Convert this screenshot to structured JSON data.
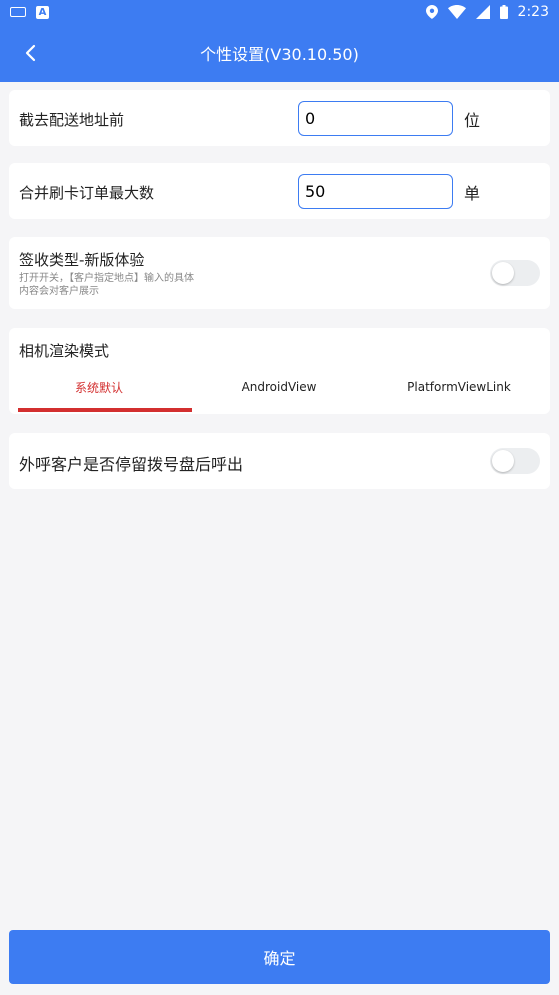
{
  "status_bar": {
    "time": "2:23",
    "left_icons": [
      "keyboard-icon",
      "a-icon"
    ],
    "right_icons": [
      "location-icon",
      "wifi-icon",
      "signal-icon",
      "battery-icon"
    ]
  },
  "header": {
    "title": "个性设置(V30.10.50)",
    "back_icon": "chevron-left-icon"
  },
  "settings": {
    "trim_address": {
      "label": "截去配送地址前",
      "value": "0",
      "unit": "位"
    },
    "merge_max": {
      "label": "合并刷卡订单最大数",
      "value": "50",
      "unit": "单"
    },
    "sign_type": {
      "label": "签收类型-新版体验",
      "hint_line1": "打开开关，【客户指定地点】输入的具体",
      "hint_line2": "内容会对客户展示",
      "enabled": false
    },
    "camera_mode": {
      "label": "相机渲染模式",
      "tabs": [
        "系统默认",
        "AndroidView",
        "PlatformViewLink"
      ],
      "selected": 0
    },
    "outbound_call": {
      "label": "外呼客户是否停留拨号盘后呼出",
      "enabled": false
    }
  },
  "footer": {
    "confirm_label": "确定"
  },
  "colors": {
    "primary": "#3d7cf2",
    "tab_active": "#d32f2f",
    "background": "#f5f5f7"
  }
}
